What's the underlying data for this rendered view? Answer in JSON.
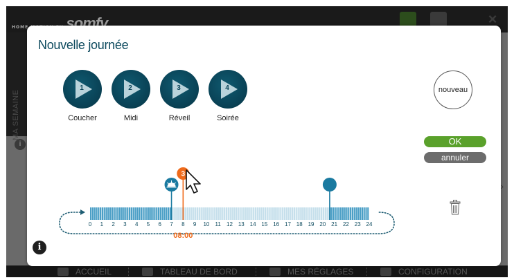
{
  "background": {
    "brand_tagline": "HOME MOTION BY",
    "brand_name": "somfy",
    "side_label": "MA SEMAINE",
    "nav": [
      {
        "label": "ACCUEIL",
        "icon": "home-icon"
      },
      {
        "label": "TABLEAU DE BORD",
        "icon": "dashboard-icon"
      },
      {
        "label": "MES RÉGLAGES",
        "icon": "user-icon"
      },
      {
        "label": "CONFIGURATION",
        "icon": "gear-icon"
      }
    ]
  },
  "modal": {
    "title": "Nouvelle journée",
    "scenes": [
      {
        "number": "1",
        "label": "Coucher"
      },
      {
        "number": "2",
        "label": "Midi"
      },
      {
        "number": "3",
        "label": "Réveil"
      },
      {
        "number": "4",
        "label": "Soirée"
      }
    ],
    "new_button": "nouveau",
    "ok_button": "OK",
    "cancel_button": "annuler",
    "info_glyph": "i"
  },
  "timeline": {
    "hours": [
      "0",
      "1",
      "2",
      "3",
      "4",
      "5",
      "6",
      "7",
      "8",
      "9",
      "10",
      "11",
      "12",
      "13",
      "14",
      "15",
      "16",
      "17",
      "18",
      "19",
      "20",
      "21",
      "22",
      "23",
      "24"
    ],
    "selected_time": "08:00",
    "markers": [
      {
        "icon": "sunrise-icon",
        "hour": 7,
        "color": "#1a7aa0"
      },
      {
        "icon": "scene-3-marker",
        "label": "3",
        "hour": 8,
        "color": "#ef6a1a"
      },
      {
        "icon": "moon-icon",
        "hour": 20.6,
        "color": "#1a7aa0"
      }
    ],
    "filled_ranges": [
      [
        0,
        7
      ],
      [
        20.6,
        24
      ]
    ],
    "colors": {
      "filled": "#4b9fc6",
      "empty": "#c5dfeb",
      "track_dots": "#1e5d73",
      "accent": "#ef6a1a"
    }
  }
}
